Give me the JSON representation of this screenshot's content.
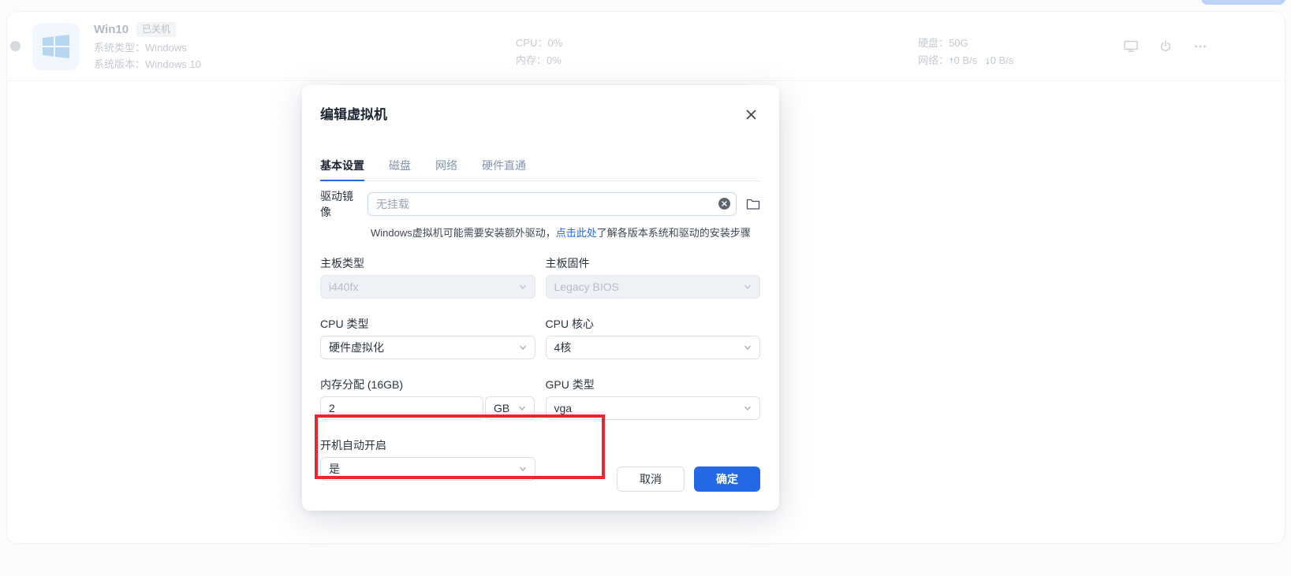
{
  "vm_card": {
    "name": "Win10",
    "status_badge": "已关机",
    "os_type_label": "系统类型：",
    "os_type_value": "Windows",
    "os_version_label": "系统版本：",
    "os_version_value": "Windows 10",
    "cpu_label": "CPU：",
    "cpu_value": "0%",
    "mem_label": "内存：",
    "mem_value": "0%",
    "disk_label": "硬盘：",
    "disk_value": "50G",
    "net_label": "网络：",
    "up_arrow": "↑",
    "net_up": "0 B/s",
    "down_arrow": "↓",
    "net_down": "0 B/s"
  },
  "modal": {
    "title": "编辑虚拟机",
    "tabs": [
      {
        "label": "基本设置",
        "active": true
      },
      {
        "label": "磁盘",
        "active": false
      },
      {
        "label": "网络",
        "active": false
      },
      {
        "label": "硬件直通",
        "active": false
      }
    ],
    "fields": {
      "drive_image": {
        "label": "驱动镜像",
        "placeholder": "无挂载"
      },
      "helper": {
        "pre": "Windows虚拟机可能需要安装额外驱动，",
        "link": "点击此处",
        "post": "了解各版本系统和驱动的安装步骤"
      },
      "board_type": {
        "label": "主板类型",
        "value": "i440fx"
      },
      "board_firmware": {
        "label": "主板固件",
        "value": "Legacy BIOS"
      },
      "cpu_type": {
        "label": "CPU 类型",
        "value": "硬件虚拟化"
      },
      "cpu_cores": {
        "label": "CPU 核心",
        "value": "4核"
      },
      "memory": {
        "label": "内存分配 (16GB)",
        "value": "2",
        "unit": "GB"
      },
      "gpu_type": {
        "label": "GPU 类型",
        "value": "vga"
      },
      "auto_start": {
        "label": "开机自动开启",
        "value": "是"
      }
    },
    "buttons": {
      "cancel": "取消",
      "confirm": "确定"
    }
  },
  "colors": {
    "primary": "#2468e5",
    "link": "#2468e5",
    "annotation_red": "#e8282c",
    "net_up_blue": "#74aede",
    "net_down_green": "#7cc184"
  }
}
